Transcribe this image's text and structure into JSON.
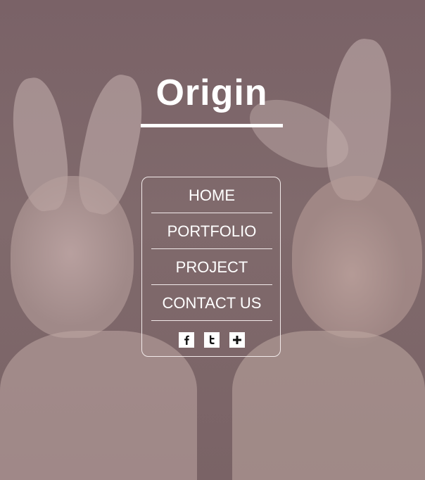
{
  "brand": {
    "logo_text": "Origin"
  },
  "menu": {
    "items": [
      {
        "label": "HOME"
      },
      {
        "label": "PORTFOLIO"
      },
      {
        "label": "PROJECT"
      },
      {
        "label": "CONTACT US"
      }
    ]
  },
  "social": [
    {
      "icon": "facebook-icon"
    },
    {
      "icon": "twitter-icon"
    },
    {
      "icon": "plus-icon"
    }
  ]
}
